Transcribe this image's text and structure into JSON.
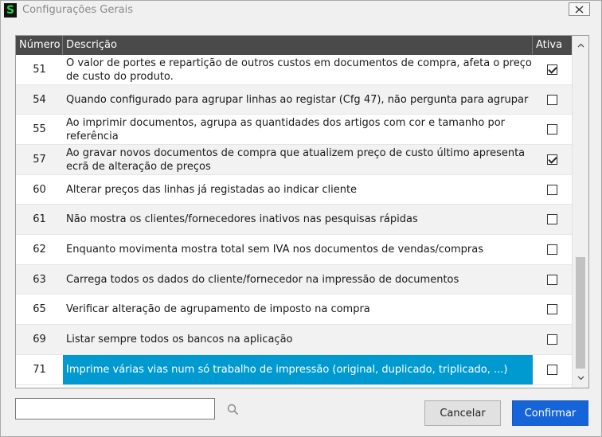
{
  "window": {
    "title": "Configurações Gerais",
    "app_icon_glyph": "S"
  },
  "table": {
    "columns": [
      "Número",
      "Descrição",
      "Ativa"
    ],
    "rows": [
      {
        "numero": "51",
        "descricao": "O valor de portes e repartição de outros custos em documentos de compra, afeta o preço de custo do produto.",
        "ativa": true,
        "selected": false
      },
      {
        "numero": "54",
        "descricao": "Quando configurado para agrupar linhas ao registar (Cfg 47), não pergunta para agrupar",
        "ativa": false,
        "selected": false
      },
      {
        "numero": "55",
        "descricao": "Ao imprimir documentos, agrupa as quantidades dos artigos com cor e tamanho por referência",
        "ativa": false,
        "selected": false
      },
      {
        "numero": "57",
        "descricao": "Ao gravar novos documentos de compra que atualizem preço de custo último apresenta ecrã de alteração de preços",
        "ativa": true,
        "selected": false
      },
      {
        "numero": "60",
        "descricao": "Alterar preços das linhas já registadas ao indicar cliente",
        "ativa": false,
        "selected": false
      },
      {
        "numero": "61",
        "descricao": "Não mostra os clientes/fornecedores inativos nas pesquisas rápidas",
        "ativa": false,
        "selected": false
      },
      {
        "numero": "62",
        "descricao": "Enquanto movimenta mostra total sem IVA nos documentos de vendas/compras",
        "ativa": false,
        "selected": false
      },
      {
        "numero": "63",
        "descricao": "Carrega todos os dados do cliente/fornecedor na impressão de documentos",
        "ativa": false,
        "selected": false
      },
      {
        "numero": "65",
        "descricao": "Verificar alteração de agrupamento de imposto na compra",
        "ativa": false,
        "selected": false
      },
      {
        "numero": "69",
        "descricao": "Listar sempre todos os bancos na aplicação",
        "ativa": false,
        "selected": false
      },
      {
        "numero": "71",
        "descricao": "Imprime várias vias num só trabalho de impressão (original, duplicado, triplicado, ...)",
        "ativa": false,
        "selected": true
      }
    ],
    "scroll_position": 0.85
  },
  "search": {
    "value": "",
    "placeholder": ""
  },
  "buttons": {
    "cancel": "Cancelar",
    "confirm": "Confirmar"
  },
  "colors": {
    "header_bg": "#4a4a4a",
    "selection": "#009ad0",
    "confirm_button": "#1565d8"
  }
}
